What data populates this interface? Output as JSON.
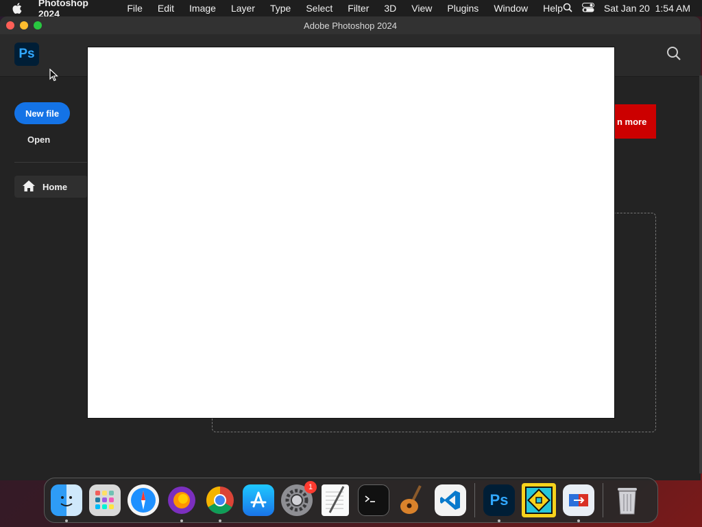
{
  "menubar": {
    "app_name": "Photoshop 2024",
    "items": [
      "File",
      "Edit",
      "Image",
      "Layer",
      "Type",
      "Select",
      "Filter",
      "3D",
      "View",
      "Plugins",
      "Window",
      "Help"
    ],
    "datetime": "Sat Jan 20  1:54 AM"
  },
  "window": {
    "title": "Adobe Photoshop 2024"
  },
  "app": {
    "logo_text": "Ps",
    "new_file_label": "New file",
    "open_label": "Open",
    "home_label": "Home",
    "learn_more_label": "n more"
  },
  "dock": {
    "apps": [
      {
        "name": "Finder",
        "icon": "finder-icon",
        "running": true
      },
      {
        "name": "Launchpad",
        "icon": "launchpad-icon",
        "running": false
      },
      {
        "name": "Safari",
        "icon": "safari-icon",
        "running": false
      },
      {
        "name": "Firefox",
        "icon": "firefox-icon",
        "running": true
      },
      {
        "name": "Chrome",
        "icon": "chrome-icon",
        "running": true
      },
      {
        "name": "App Store",
        "icon": "app-store-icon",
        "running": false
      },
      {
        "name": "System Settings",
        "icon": "system-settings-icon",
        "running": false,
        "badge": "1"
      },
      {
        "name": "TextEdit",
        "icon": "textedit-icon",
        "running": false
      },
      {
        "name": "Terminal",
        "icon": "terminal-icon",
        "running": false
      },
      {
        "name": "GarageBand",
        "icon": "garageband-icon",
        "running": false
      },
      {
        "name": "VS Code",
        "icon": "vscode-icon",
        "running": false
      },
      {
        "name": "Photoshop",
        "icon": "photoshop-icon",
        "running": true
      },
      {
        "name": "Geometry Dash",
        "icon": "geometry-dash-icon",
        "running": false
      },
      {
        "name": "Migration",
        "icon": "migration-icon",
        "running": true
      },
      {
        "name": "Trash",
        "icon": "trash-icon",
        "running": false
      }
    ]
  },
  "colors": {
    "accent_blue": "#1473e6",
    "ps_blue": "#31a8ff",
    "learn_more_red": "#cc0000"
  }
}
